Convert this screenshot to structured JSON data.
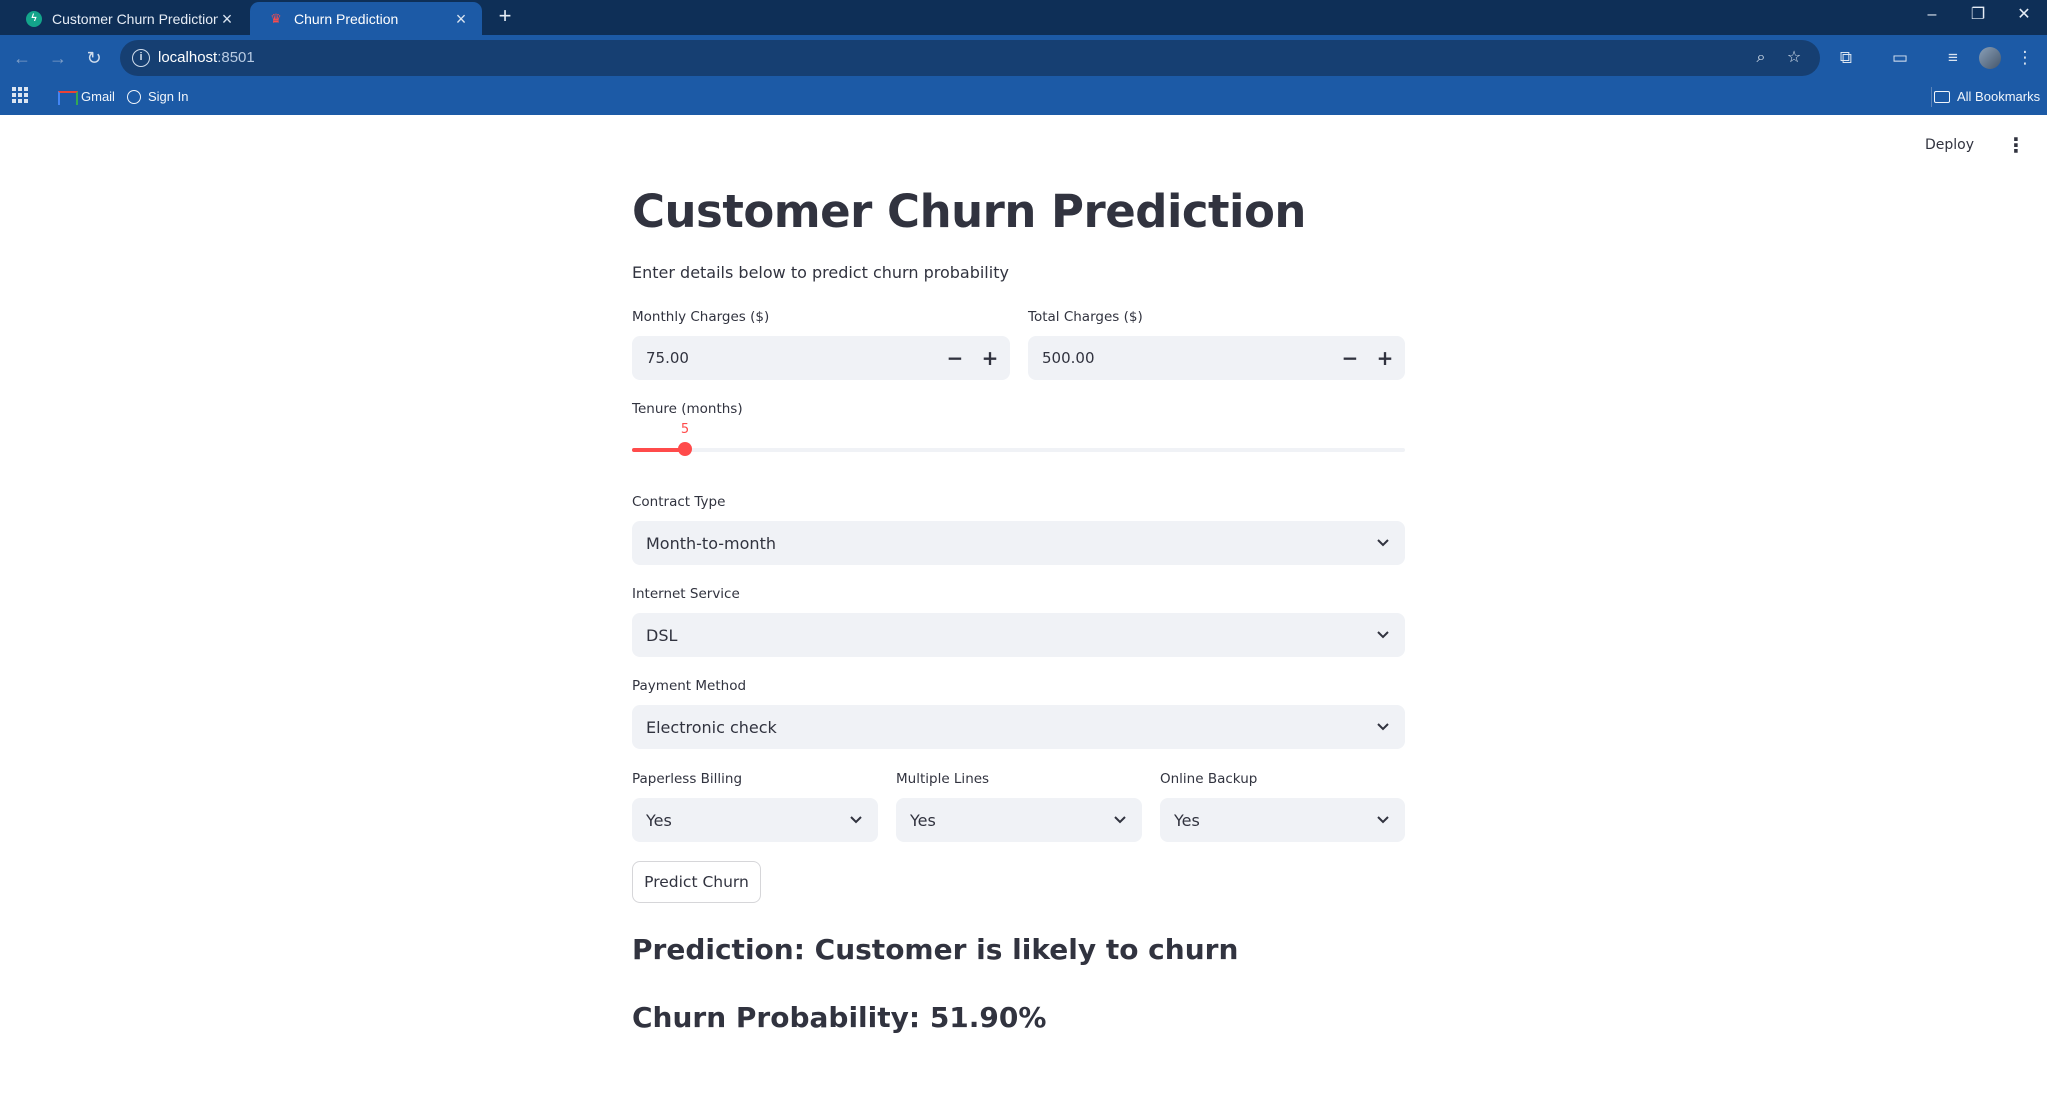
{
  "browser": {
    "tabs": [
      {
        "title": "Customer Churn Prediction API",
        "active": false,
        "favicon": "fastapi-icon"
      },
      {
        "title": "Churn Prediction",
        "active": true,
        "favicon": "streamlit-icon"
      }
    ],
    "url_host": "localhost",
    "url_port": ":8501",
    "bookmarks": [
      {
        "label": "Gmail",
        "icon": "gmail-icon"
      },
      {
        "label": "Sign In",
        "icon": "globe-icon"
      }
    ],
    "all_bookmarks_label": "All Bookmarks"
  },
  "app": {
    "deploy_label": "Deploy",
    "title": "Customer Churn Prediction",
    "subtitle": "Enter details below to predict churn probability",
    "monthly_charges": {
      "label": "Monthly Charges ($)",
      "value": "75.00"
    },
    "total_charges": {
      "label": "Total Charges ($)",
      "value": "500.00"
    },
    "tenure": {
      "label": "Tenure (months)",
      "value": "5",
      "fraction": 0.069
    },
    "contract_type": {
      "label": "Contract Type",
      "value": "Month-to-month"
    },
    "internet_service": {
      "label": "Internet Service",
      "value": "DSL"
    },
    "payment_method": {
      "label": "Payment Method",
      "value": "Electronic check"
    },
    "paperless_billing": {
      "label": "Paperless Billing",
      "value": "Yes"
    },
    "multiple_lines": {
      "label": "Multiple Lines",
      "value": "Yes"
    },
    "online_backup": {
      "label": "Online Backup",
      "value": "Yes"
    },
    "predict_button": "Predict Churn",
    "prediction_text": "Prediction: Customer is likely to churn",
    "probability_text": "Churn Probability: 51.90%"
  },
  "colors": {
    "accent": "#ff4b4b",
    "input_bg": "#f0f2f6",
    "text": "#31333f",
    "chrome_dark": "#0e2f57",
    "chrome": "#1c5aa6"
  }
}
